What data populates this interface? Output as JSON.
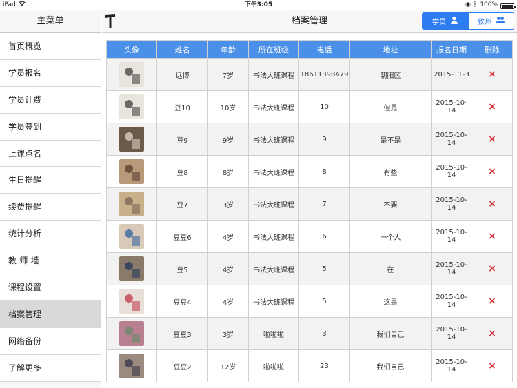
{
  "status": {
    "device": "iPad",
    "time": "下午3:05",
    "battery": "100%",
    "battery_level": 1.0
  },
  "sidebar": {
    "title": "主菜单",
    "items": [
      {
        "label": "首页概览"
      },
      {
        "label": "学员报名"
      },
      {
        "label": "学员计费"
      },
      {
        "label": "学员签到"
      },
      {
        "label": "上课点名"
      },
      {
        "label": "生日提醒"
      },
      {
        "label": "续费提醒"
      },
      {
        "label": "统计分析"
      },
      {
        "label": "教-师-墙"
      },
      {
        "label": "课程设置"
      },
      {
        "label": "档案管理"
      },
      {
        "label": "网络备份"
      },
      {
        "label": "了解更多"
      }
    ],
    "active_index": 10
  },
  "header": {
    "title": "档案管理",
    "segment": {
      "student": "学员",
      "teacher": "教师"
    }
  },
  "table": {
    "columns": [
      "头像",
      "姓名",
      "年龄",
      "所在班级",
      "电话",
      "地址",
      "报名日期",
      "删除"
    ],
    "rows": [
      {
        "name": "远博",
        "age": "7岁",
        "class": "书法大班课程",
        "phone": "18611398479",
        "address": "朝阳区",
        "date": "2015-11-3"
      },
      {
        "name": "豆10",
        "age": "10岁",
        "class": "书法大班课程",
        "phone": "10",
        "address": "但是",
        "date": "2015-10-14"
      },
      {
        "name": "豆9",
        "age": "9岁",
        "class": "书法大班课程",
        "phone": "9",
        "address": "是不是",
        "date": "2015-10-14"
      },
      {
        "name": "豆8",
        "age": "8岁",
        "class": "书法大班课程",
        "phone": "8",
        "address": "有些",
        "date": "2015-10-14"
      },
      {
        "name": "豆7",
        "age": "3岁",
        "class": "书法大班课程",
        "phone": "7",
        "address": "不要",
        "date": "2015-10-14"
      },
      {
        "name": "豆豆6",
        "age": "4岁",
        "class": "书法大班课程",
        "phone": "6",
        "address": "一个人",
        "date": "2015-10-14"
      },
      {
        "name": "豆5",
        "age": "4岁",
        "class": "书法大班课程",
        "phone": "5",
        "address": "在",
        "date": "2015-10-14"
      },
      {
        "name": "豆豆4",
        "age": "4岁",
        "class": "书法大班课程",
        "phone": "5",
        "address": "这是",
        "date": "2015-10-14"
      },
      {
        "name": "豆豆3",
        "age": "3岁",
        "class": "啦啦啦",
        "phone": "3",
        "address": "我们自己",
        "date": "2015-10-14"
      },
      {
        "name": "豆豆2",
        "age": "12岁",
        "class": "啦啦啦",
        "phone": "23",
        "address": "我们自己",
        "date": "2015-10-14"
      }
    ],
    "delete_icon": "×"
  },
  "colors": {
    "accent": "#2d7cf0",
    "header_bg": "#4a90e8",
    "delete": "#d9343b",
    "active_item": "#d9d9d9"
  }
}
